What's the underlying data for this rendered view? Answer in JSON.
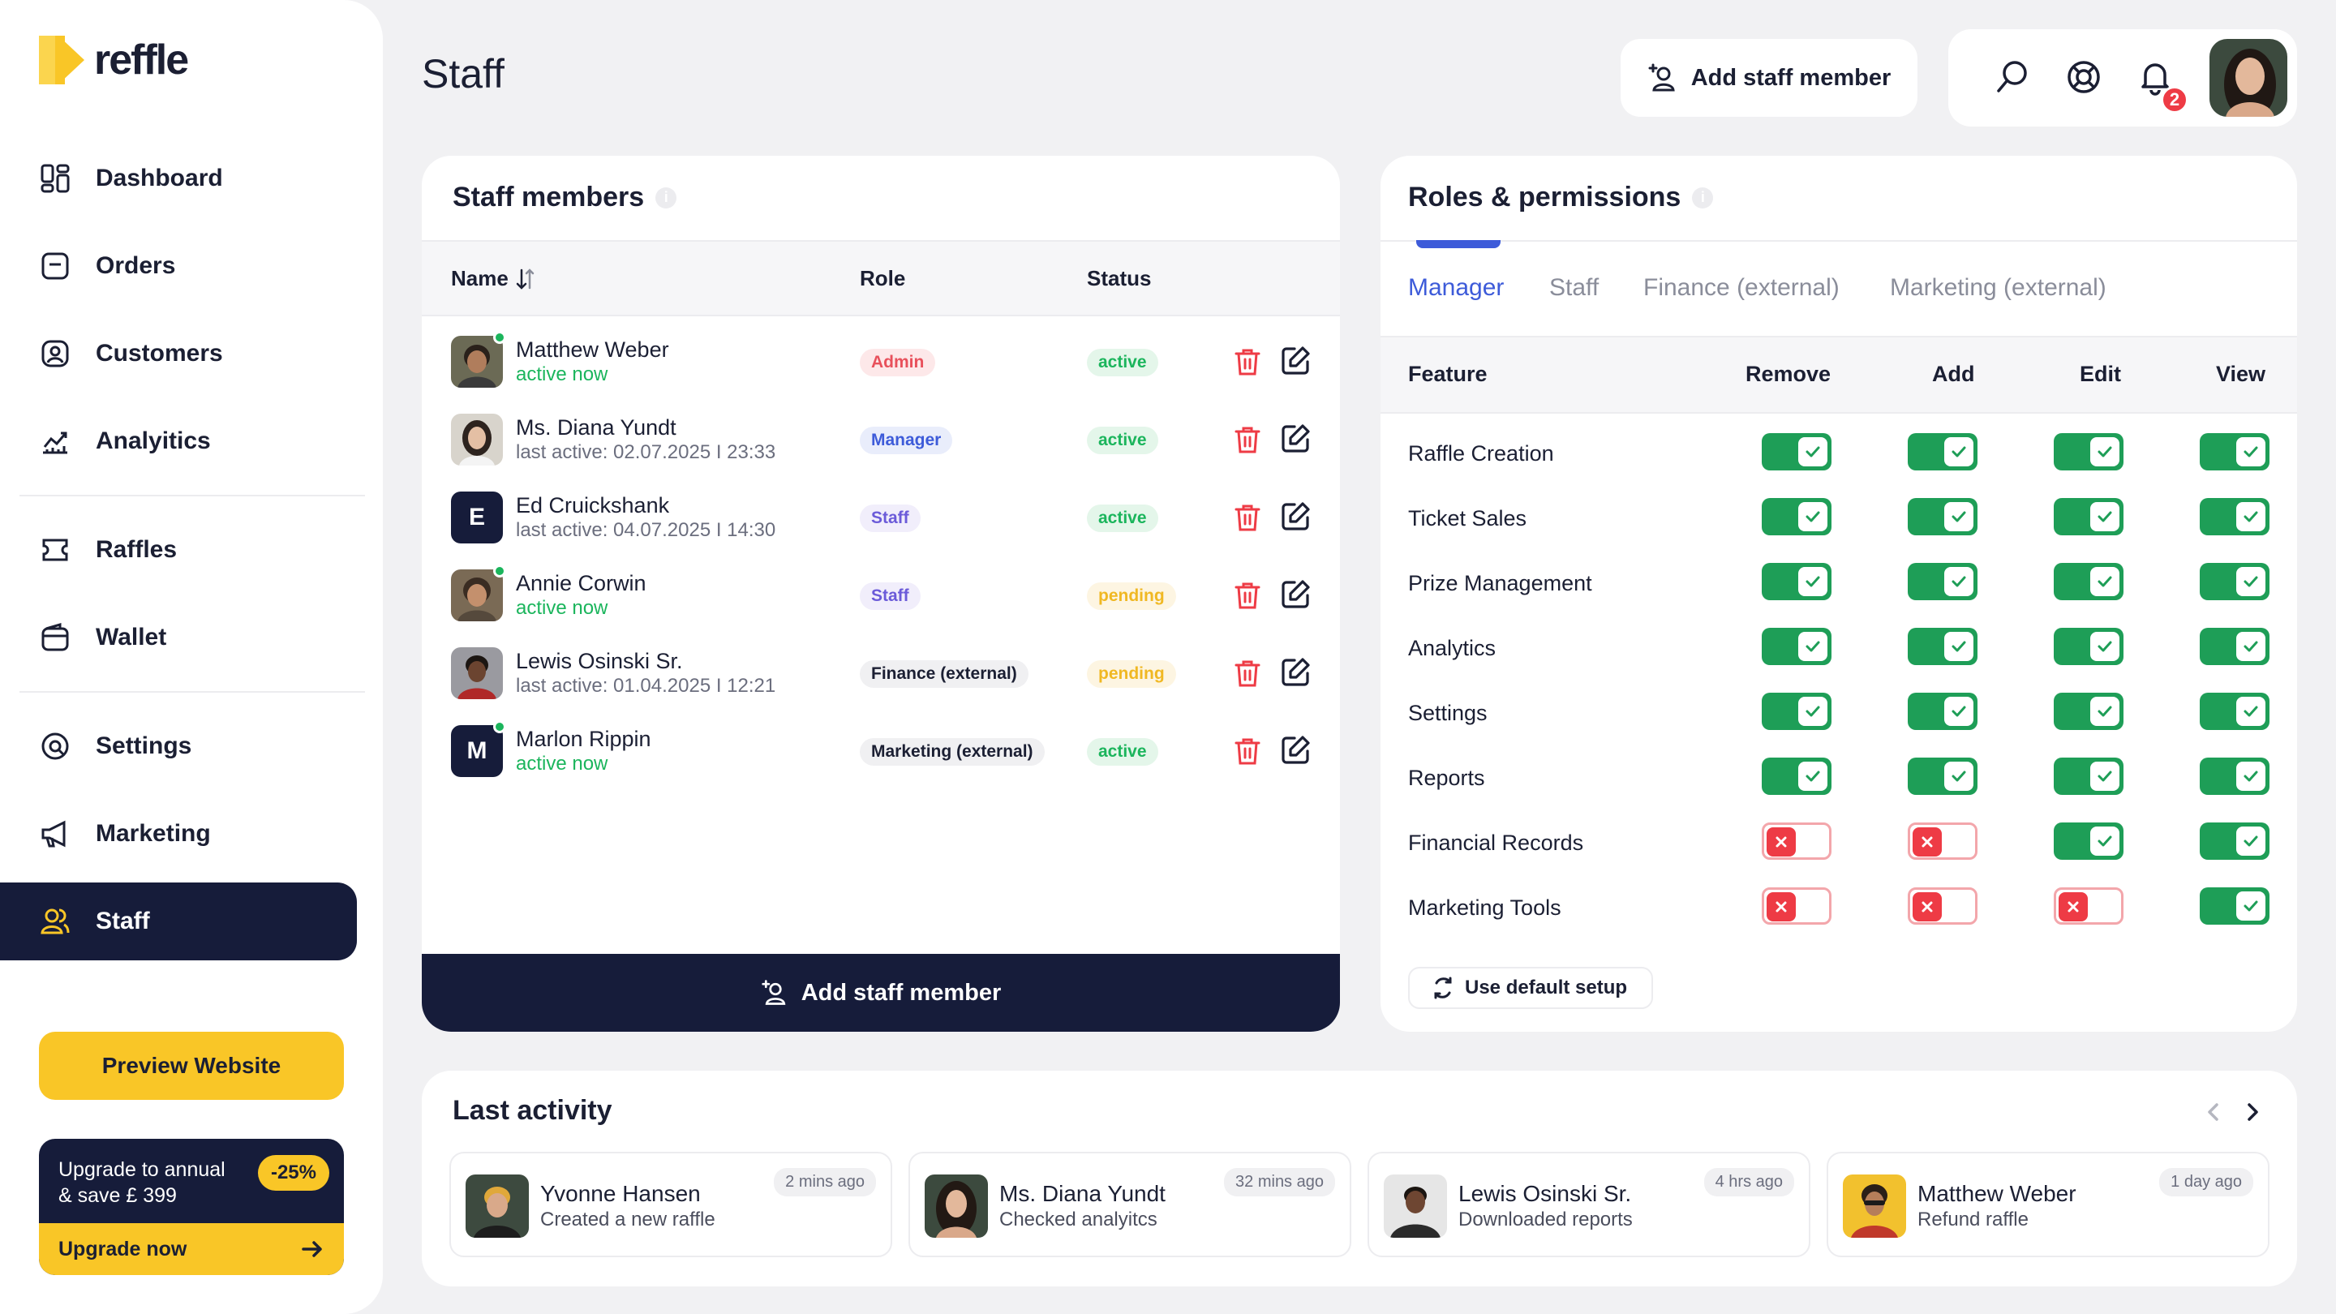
{
  "brand": {
    "name": "reffle",
    "accent": "#f9c627",
    "dark": "#161c3a"
  },
  "sidebar": {
    "items": [
      {
        "label": "Dashboard",
        "icon": "dashboard-icon"
      },
      {
        "label": "Orders",
        "icon": "orders-icon"
      },
      {
        "label": "Customers",
        "icon": "customers-icon"
      },
      {
        "label": "Analyitics",
        "icon": "analytics-icon"
      },
      {
        "label": "Raffles",
        "icon": "raffles-icon"
      },
      {
        "label": "Wallet",
        "icon": "wallet-icon"
      },
      {
        "label": "Settings",
        "icon": "settings-icon"
      },
      {
        "label": "Marketing",
        "icon": "megaphone-icon"
      },
      {
        "label": "Staff",
        "icon": "staff-icon",
        "active": true
      }
    ],
    "preview_label": "Preview Website",
    "upgrade": {
      "text_line1": "Upgrade to annual",
      "text_line2": "& save £ 399",
      "badge": "-25%",
      "cta": "Upgrade now"
    }
  },
  "header": {
    "title": "Staff",
    "add_label": "Add staff member",
    "notifications": "2"
  },
  "staff": {
    "title": "Staff members",
    "info": "i",
    "columns": {
      "name": "Name",
      "role": "Role",
      "status": "Status"
    },
    "rows": [
      {
        "name": "Matthew Weber",
        "sub": "active now",
        "role": "Admin",
        "status": "active"
      },
      {
        "name": "Ms. Diana Yundt",
        "sub": "last active: 02.07.2025 I 23:33",
        "role": "Manager",
        "status": "active"
      },
      {
        "name": "Ed Cruickshank",
        "sub": "last active: 04.07.2025 I 14:30",
        "role": "Staff",
        "status": "active",
        "initial": "E"
      },
      {
        "name": "Annie Corwin",
        "sub": "active now",
        "role": "Staff",
        "status": "pending"
      },
      {
        "name": "Lewis Osinski Sr.",
        "sub": "last active: 01.04.2025 I 12:21",
        "role": "Finance (external)",
        "status": "pending"
      },
      {
        "name": "Marlon Rippin",
        "sub": "active now",
        "role": "Marketing (external)",
        "status": "active",
        "initial": "M"
      }
    ],
    "add_label": "Add staff member"
  },
  "roles": {
    "title": "Roles & permissions",
    "info": "i",
    "tabs": [
      "Manager",
      "Staff",
      "Finance (external)",
      "Marketing (external)"
    ],
    "active_tab": "Manager",
    "columns": {
      "feature": "Feature",
      "remove": "Remove",
      "add": "Add",
      "edit": "Edit",
      "view": "View"
    },
    "features": [
      {
        "name": "Raffle Creation",
        "remove": true,
        "add": true,
        "edit": true,
        "view": true
      },
      {
        "name": "Ticket Sales",
        "remove": true,
        "add": true,
        "edit": true,
        "view": true
      },
      {
        "name": "Prize Management",
        "remove": true,
        "add": true,
        "edit": true,
        "view": true
      },
      {
        "name": "Analytics",
        "remove": true,
        "add": true,
        "edit": true,
        "view": true
      },
      {
        "name": "Settings",
        "remove": true,
        "add": true,
        "edit": true,
        "view": true
      },
      {
        "name": "Reports",
        "remove": true,
        "add": true,
        "edit": true,
        "view": true
      },
      {
        "name": "Financial Records",
        "remove": false,
        "add": false,
        "edit": true,
        "view": true
      },
      {
        "name": "Marketing Tools",
        "remove": false,
        "add": false,
        "edit": false,
        "view": true
      }
    ],
    "default_label": "Use default setup"
  },
  "activity": {
    "title": "Last activity",
    "items": [
      {
        "name": "Yvonne Hansen",
        "desc": "Created a new raffle",
        "time": "2 mins ago"
      },
      {
        "name": "Ms. Diana Yundt",
        "desc": "Checked analyitcs",
        "time": "32 mins ago"
      },
      {
        "name": "Lewis Osinski Sr.",
        "desc": "Downloaded reports",
        "time": "4 hrs ago"
      },
      {
        "name": "Matthew Weber",
        "desc": "Refund raffle",
        "time": "1 day ago"
      }
    ]
  }
}
